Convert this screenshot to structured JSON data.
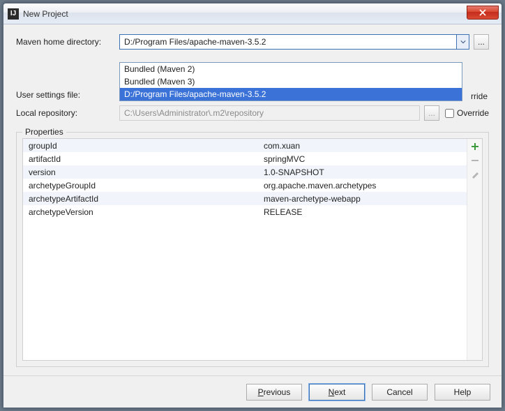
{
  "window": {
    "title": "New Project"
  },
  "form": {
    "maven_home_label": "Maven home directory:",
    "maven_home_value": "D:/Program Files/apache-maven-3.5.2",
    "user_settings_label": "User settings file:",
    "user_settings_value": "",
    "local_repo_label": "Local repository:",
    "local_repo_value": "C:\\Users\\Administrator\\.m2\\repository",
    "override_label": "Override",
    "override_partial": "rride"
  },
  "dropdown": {
    "items": [
      {
        "label": "Bundled (Maven 2)",
        "selected": false
      },
      {
        "label": "Bundled (Maven 3)",
        "selected": false
      },
      {
        "label": "D:/Program Files/apache-maven-3.5.2",
        "selected": true
      }
    ]
  },
  "properties": {
    "group_label": "Properties",
    "rows": [
      {
        "k": "groupId",
        "v": "com.xuan"
      },
      {
        "k": "artifactId",
        "v": "springMVC"
      },
      {
        "k": "version",
        "v": "1.0-SNAPSHOT"
      },
      {
        "k": "archetypeGroupId",
        "v": "org.apache.maven.archetypes"
      },
      {
        "k": "archetypeArtifactId",
        "v": "maven-archetype-webapp"
      },
      {
        "k": "archetypeVersion",
        "v": "RELEASE"
      }
    ]
  },
  "footer": {
    "previous": "Previous",
    "next": "Next",
    "cancel": "Cancel",
    "help": "Help"
  }
}
